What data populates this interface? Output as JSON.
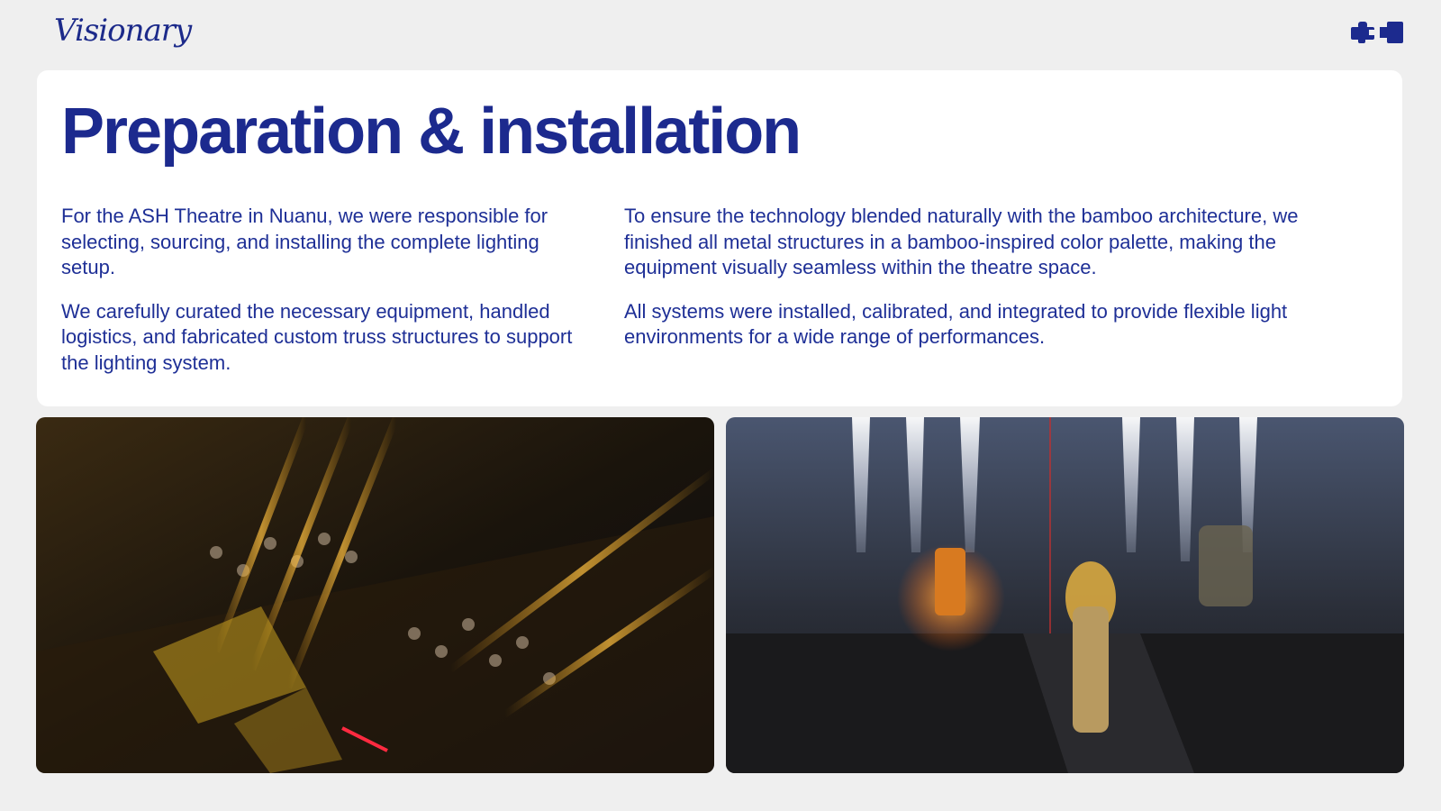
{
  "header": {
    "logo_text": "Visionary",
    "brand_icon": "puzzle-camera-icon",
    "accent_color": "#1c2a8e"
  },
  "card": {
    "title": "Preparation & installation",
    "left_paragraphs": [
      "For the ASH Theatre in Nuanu, we were responsible for selecting, sourcing, and installing the complete lighting setup.",
      "We carefully curated the necessary equipment, handled logistics, and fabricated custom truss structures to support the lighting system."
    ],
    "right_paragraphs": [
      "To ensure the technology blended naturally with the bamboo architecture, we finished all metal structures in a bamboo-inspired color palette, making the equipment visually seamless within the theatre space.",
      "All systems were installed, calibrated, and integrated to provide flexible light environments for a wide range of performances."
    ]
  },
  "photos": {
    "left_icon": "theatre-audience-photo",
    "right_icon": "stage-performance-photo"
  }
}
